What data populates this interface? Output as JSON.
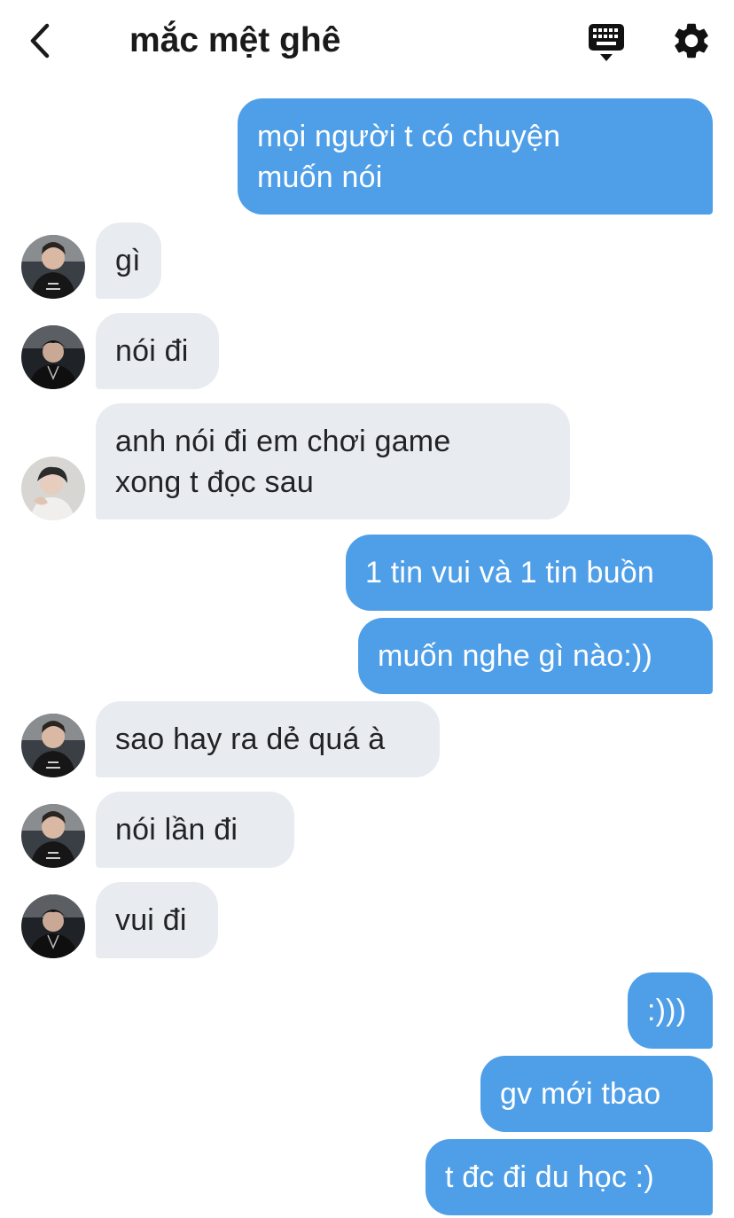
{
  "header": {
    "title": "mắc mệt ghê",
    "back_icon": "chevron-left-icon",
    "keyboard_icon": "keyboard-icon",
    "settings_icon": "gear-icon"
  },
  "colors": {
    "outgoing_bubble": "#4f9fe8",
    "incoming_bubble": "#e8ebef"
  },
  "messages": [
    {
      "sender": "me",
      "text": "mọi người t có chuyện\nmuốn nói"
    },
    {
      "sender": "other",
      "text": "gì"
    },
    {
      "sender": "other",
      "text": "nói đi"
    },
    {
      "sender": "other",
      "text": "anh nói đi em chơi game\nxong t đọc sau"
    },
    {
      "sender": "me",
      "text": "1 tin vui và 1 tin buồn"
    },
    {
      "sender": "me",
      "text": "muốn nghe gì nào:))"
    },
    {
      "sender": "other",
      "text": "sao hay ra dẻ quá à"
    },
    {
      "sender": "other",
      "text": " nói lần đi"
    },
    {
      "sender": "other",
      "text": "vui đi"
    },
    {
      "sender": "me",
      "text": ":)))"
    },
    {
      "sender": "me",
      "text": "gv mới tbao"
    },
    {
      "sender": "me",
      "text": "t đc đi du học :)"
    }
  ]
}
